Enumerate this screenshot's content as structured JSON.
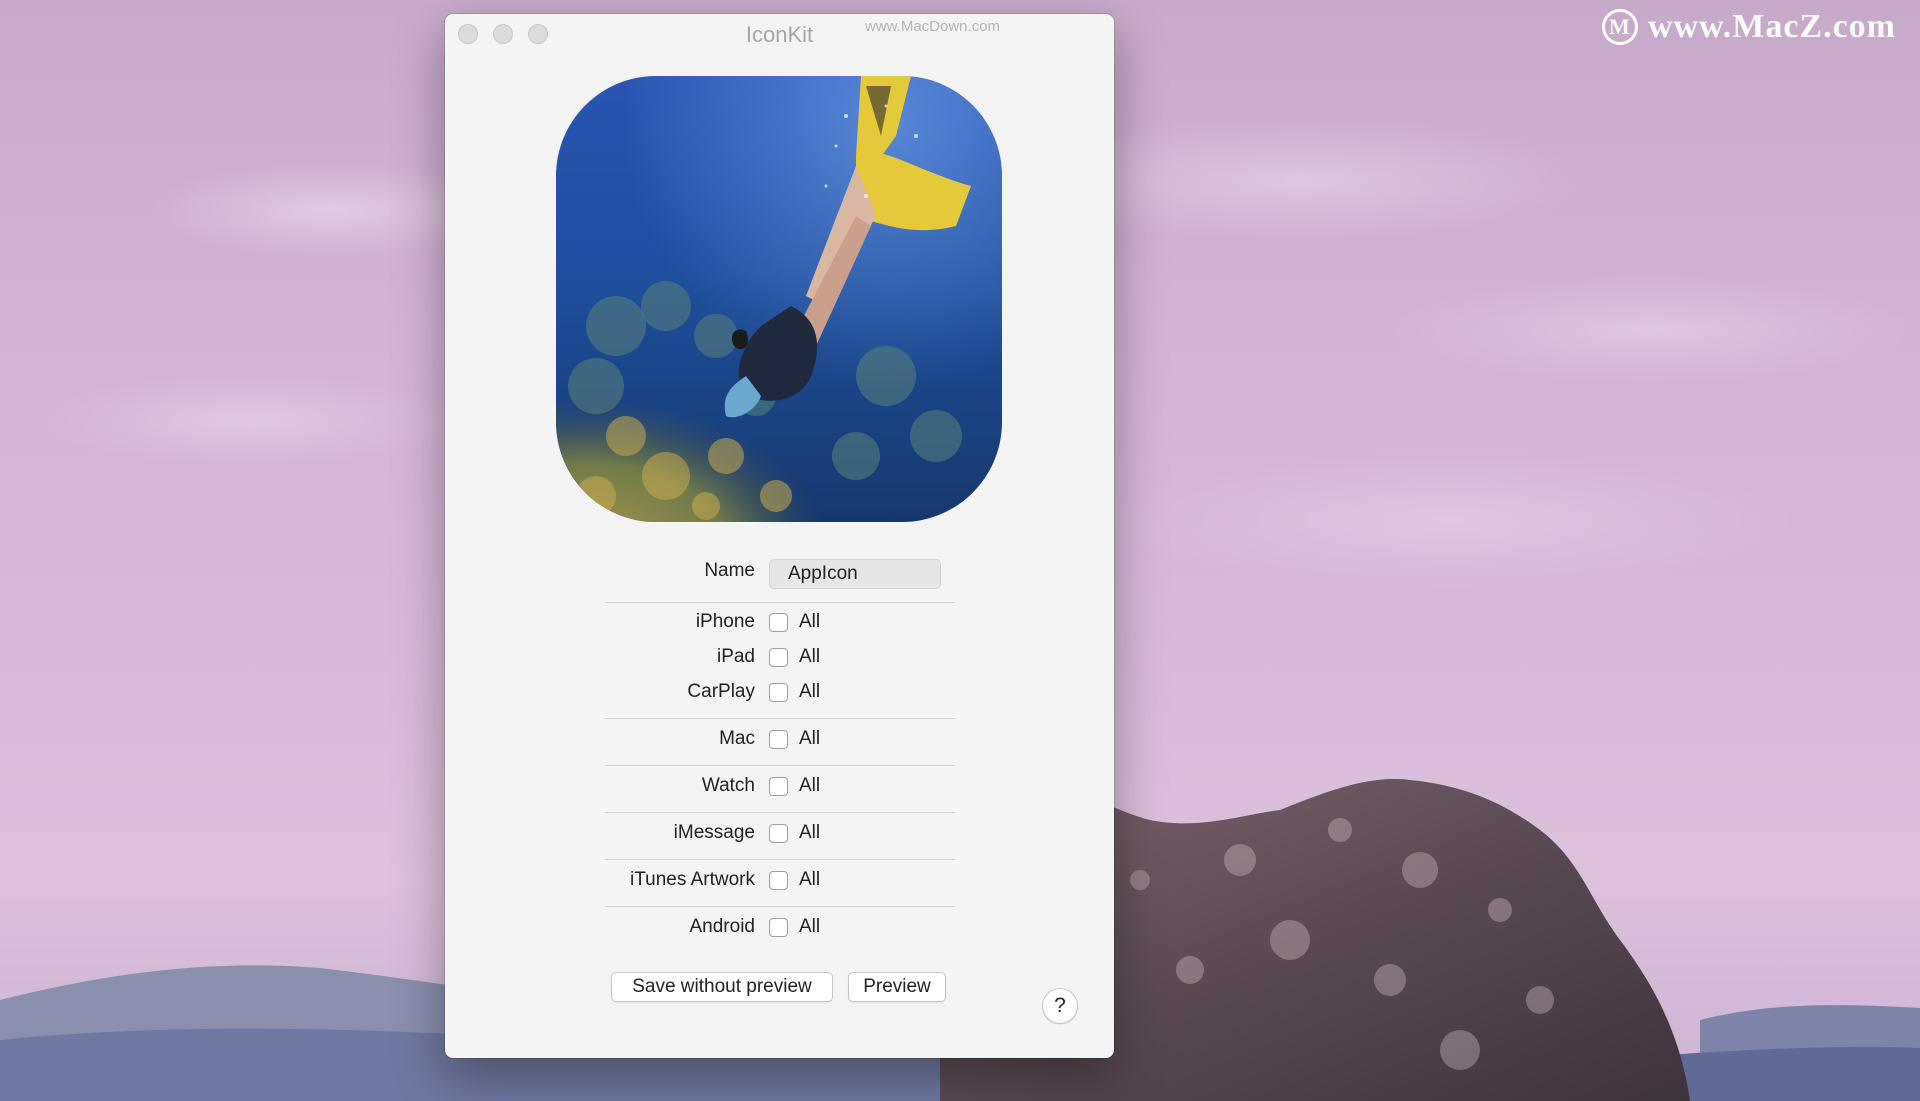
{
  "desktop": {
    "watermark_right": "www.MacZ.com",
    "watermark_logo_letter": "M"
  },
  "window": {
    "title": "IconKit",
    "watermark": "www.MacDown.com",
    "icon_preview_description_name": "appicon-preview-image",
    "form": {
      "name_label": "Name",
      "name_value": "AppIcon",
      "platforms": [
        {
          "label": "iPhone",
          "option": "All",
          "checked": false
        },
        {
          "label": "iPad",
          "option": "All",
          "checked": false
        },
        {
          "label": "CarPlay",
          "option": "All",
          "checked": false
        },
        {
          "label": "Mac",
          "option": "All",
          "checked": false
        },
        {
          "label": "Watch",
          "option": "All",
          "checked": false
        },
        {
          "label": "iMessage",
          "option": "All",
          "checked": false
        },
        {
          "label": "iTunes Artwork",
          "option": "All",
          "checked": false
        },
        {
          "label": "Android",
          "option": "All",
          "checked": false
        }
      ]
    },
    "buttons": {
      "save_without_preview": "Save without preview",
      "preview": "Preview",
      "help": "?"
    }
  },
  "colors": {
    "window_bg": "#f4f4f4",
    "sky": "#d1b3d3",
    "ocean_blue": "#1f4f9e"
  }
}
